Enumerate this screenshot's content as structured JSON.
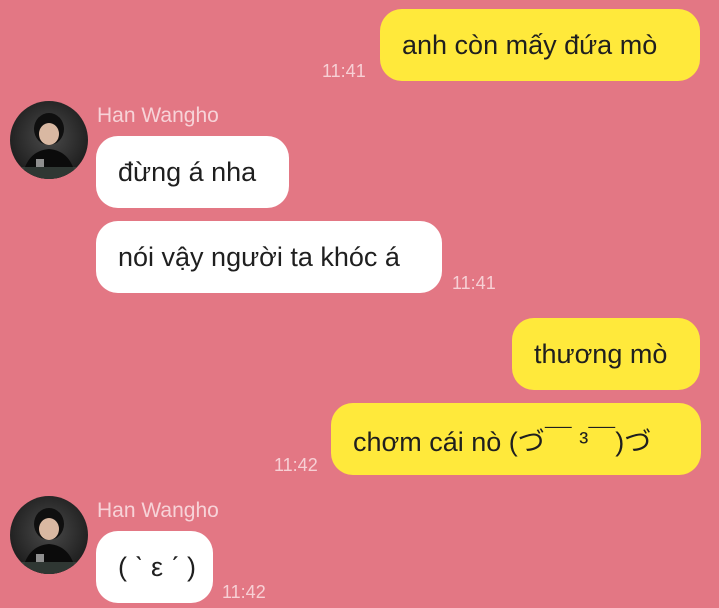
{
  "messages": [
    {
      "direction": "out",
      "text": "anh còn mấy đứa mò",
      "time": "11:41"
    },
    {
      "direction": "in",
      "sender": "Han Wangho",
      "text": "đừng á nha"
    },
    {
      "direction": "in",
      "text": "nói vậy người ta khóc á",
      "time": "11:41"
    },
    {
      "direction": "out",
      "text": "thương mò"
    },
    {
      "direction": "out",
      "text": "chơm cái nò (づ￣ ³￣)づ",
      "time": "11:42"
    },
    {
      "direction": "in",
      "sender": "Han Wangho",
      "text": "( ˋ ε ˊ )",
      "time": "11:42"
    }
  ],
  "colors": {
    "background": "#e37784",
    "outgoing_bubble": "#ffe93b",
    "incoming_bubble": "#ffffff",
    "timestamp": "#f7d0d5",
    "sender_name": "#f7d3d8"
  },
  "icons": {
    "avatar": "profile-photo-avatar"
  }
}
